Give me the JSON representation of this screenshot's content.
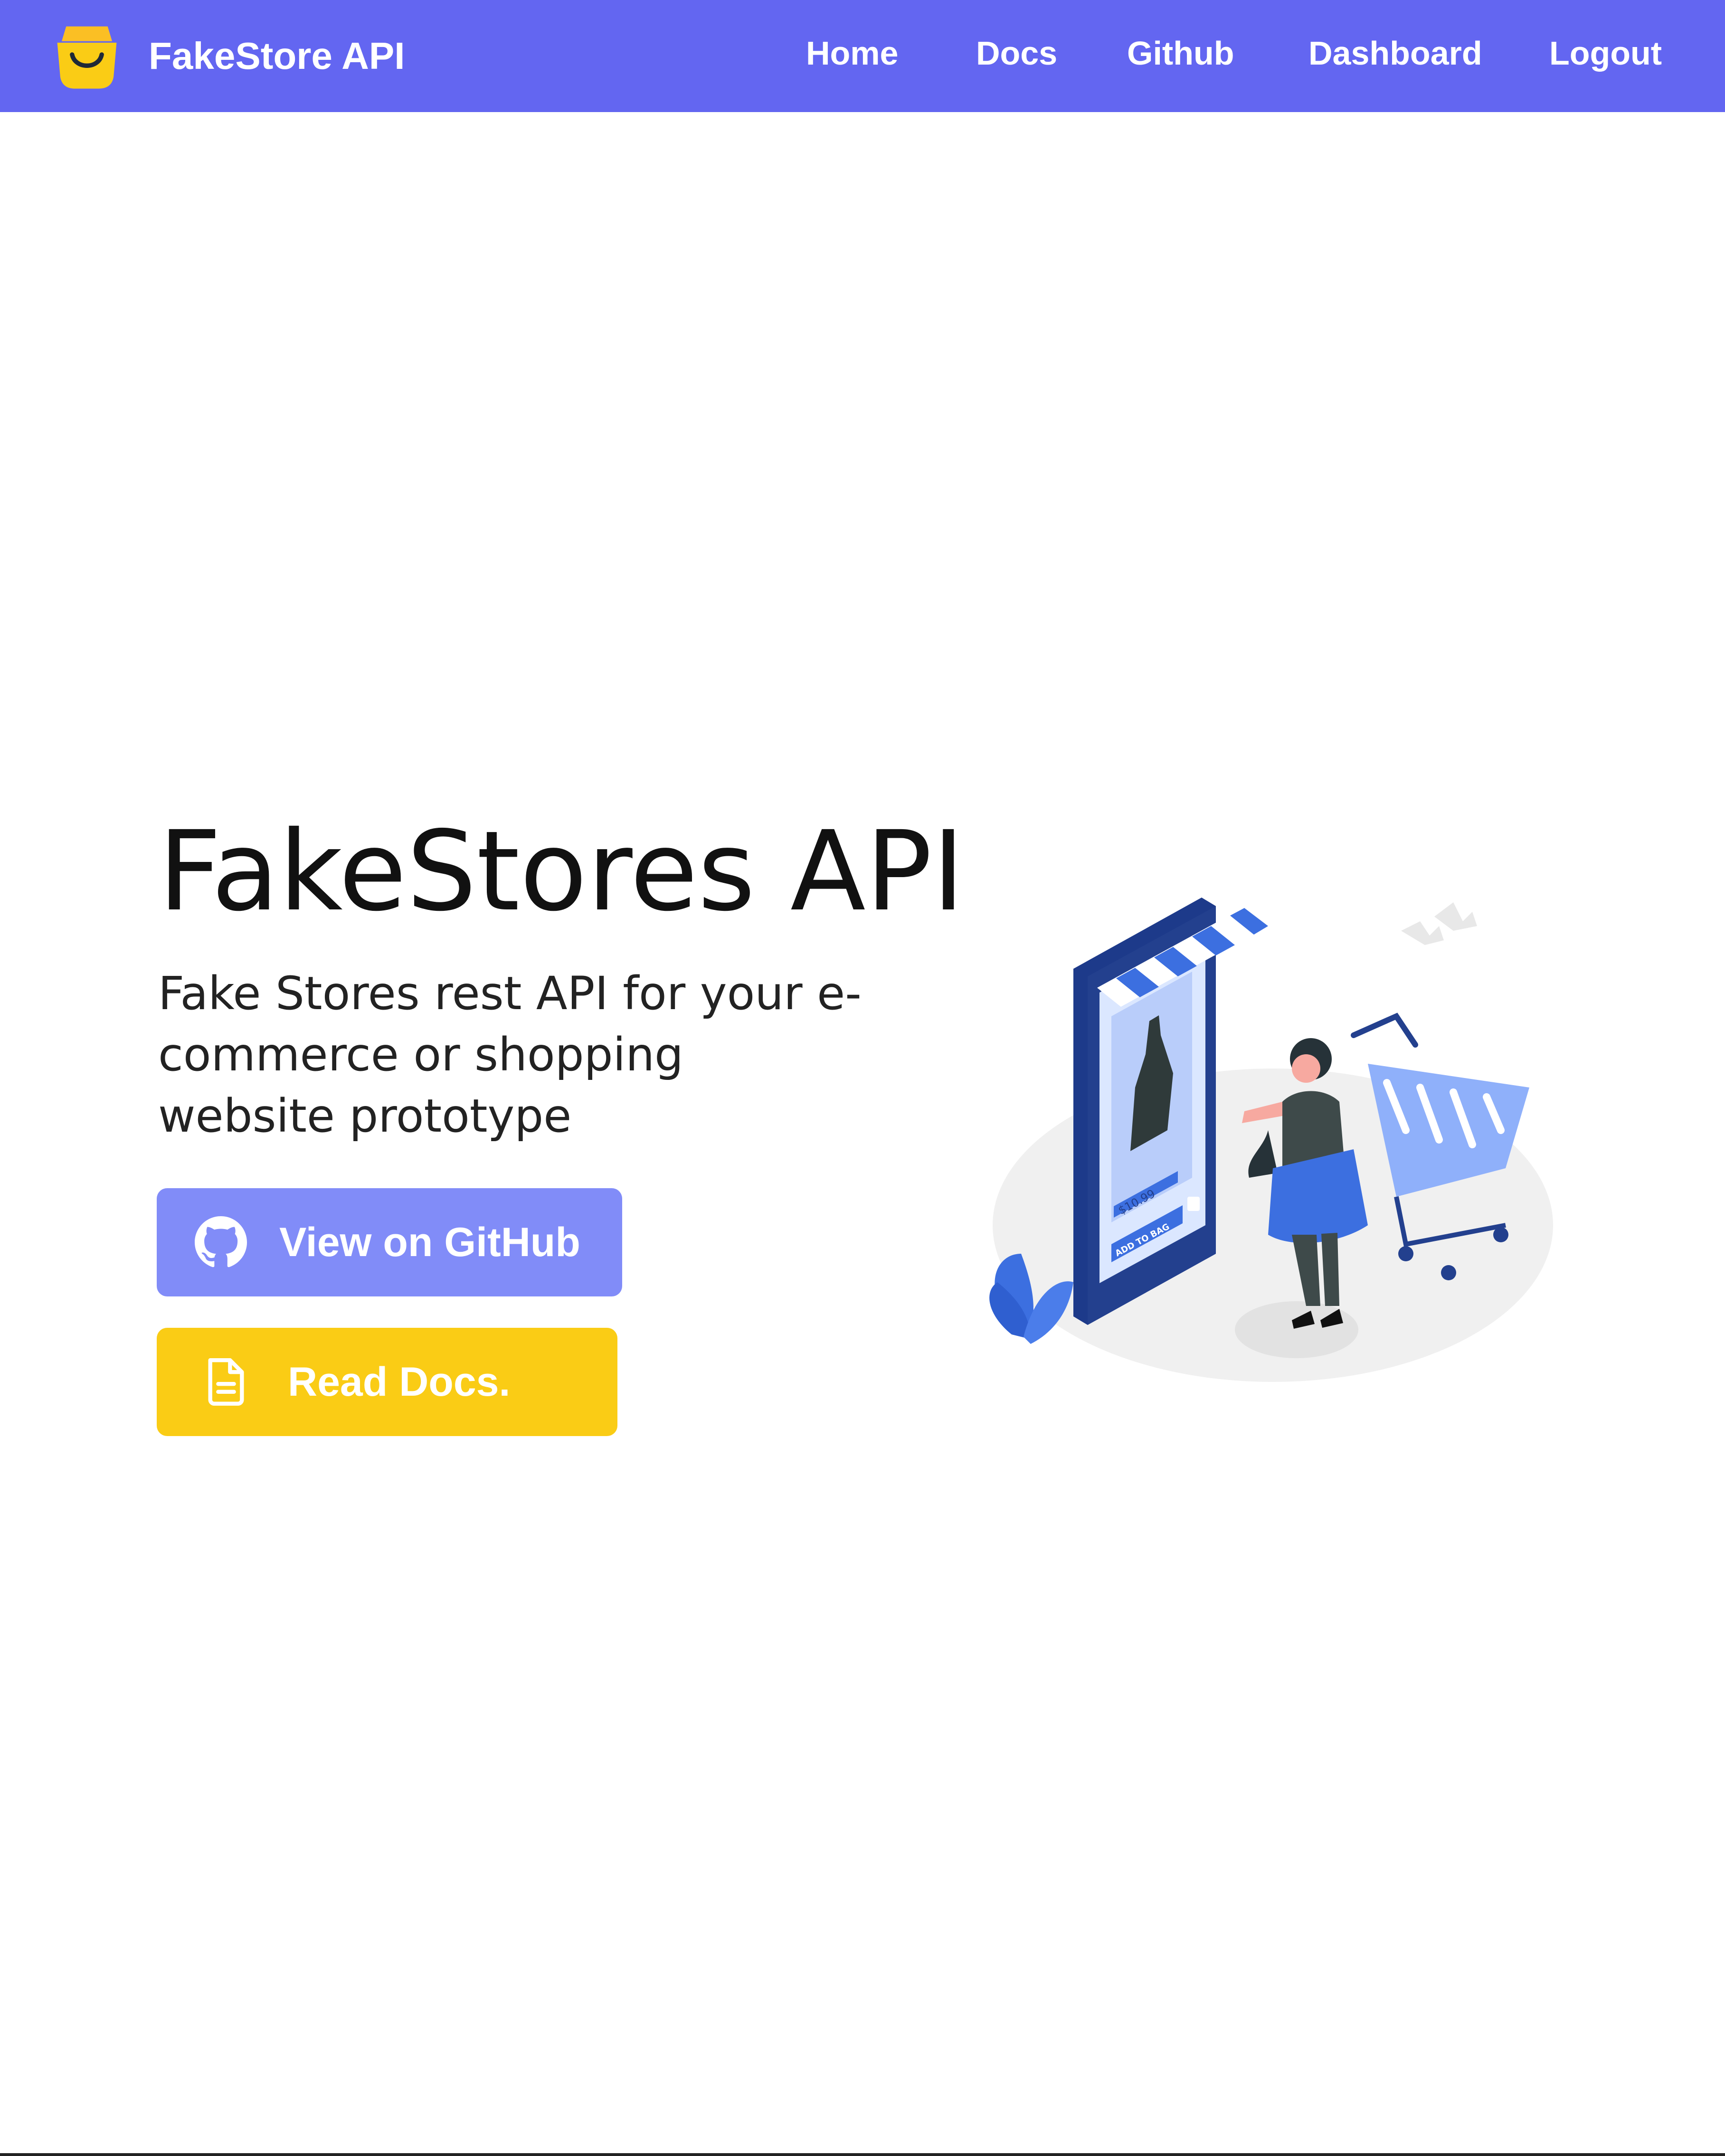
{
  "navbar": {
    "brand_name": "FakeStore API",
    "links": [
      {
        "label": "Home"
      },
      {
        "label": "Docs"
      },
      {
        "label": "Github"
      },
      {
        "label": "Dashboard"
      },
      {
        "label": "Logout"
      }
    ]
  },
  "hero": {
    "title": "FakeStores API",
    "subtitle": "Fake Stores rest API for your e-commerce or shopping website prototype",
    "buttons": {
      "github_label": "View on GitHub",
      "docs_label": "Read Docs."
    },
    "illustration": {
      "price_tag": "$10.99",
      "add_to_bag": "ADD TO BAG"
    }
  },
  "icons": {
    "brand": "shopping-bag-smile-icon",
    "github": "github-icon",
    "docs": "document-icon"
  },
  "colors": {
    "navbar_bg": "#6366f1",
    "github_button": "#818cf8",
    "docs_button": "#facc15",
    "illustration_blue": "#3c6fe0",
    "illustration_navy": "#23408e"
  }
}
